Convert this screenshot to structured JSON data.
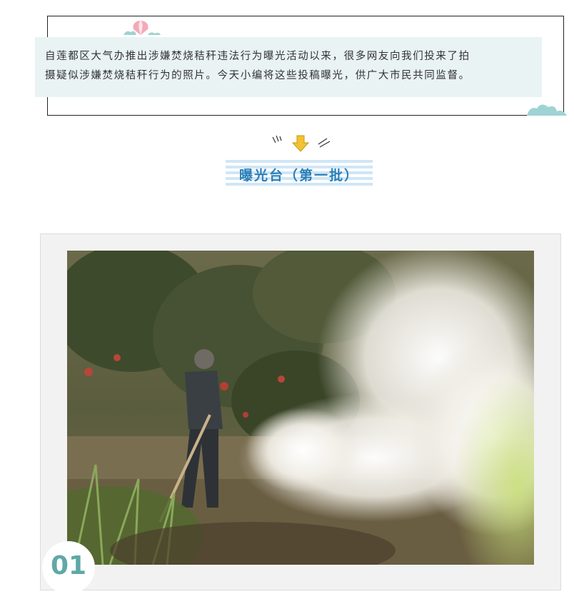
{
  "intro": {
    "line1": "自莲都区大气办推出涉嫌焚烧秸秆违法行为曝光活动以来，很多网友向我们投来了拍",
    "line2": "摄疑似涉嫌焚烧秸秆行为的照片。今天小编将这些投稿曝光，供广大市民共同监督。"
  },
  "section": {
    "title": "曝光台（第一批）"
  },
  "photo_item": {
    "number": "01"
  },
  "icons": [
    "balloon-icon",
    "cloud-icon",
    "down-arrow-icon",
    "spark-left-icon",
    "spark-right-icon"
  ],
  "colors": {
    "intro_bg": "#e9f3f3",
    "title_text": "#2a7fb8",
    "title_stripes": "#cfe6f6",
    "arrow": "#f2c230",
    "badge_text": "#5fa8a8",
    "card_bg": "#f2f2f2"
  }
}
